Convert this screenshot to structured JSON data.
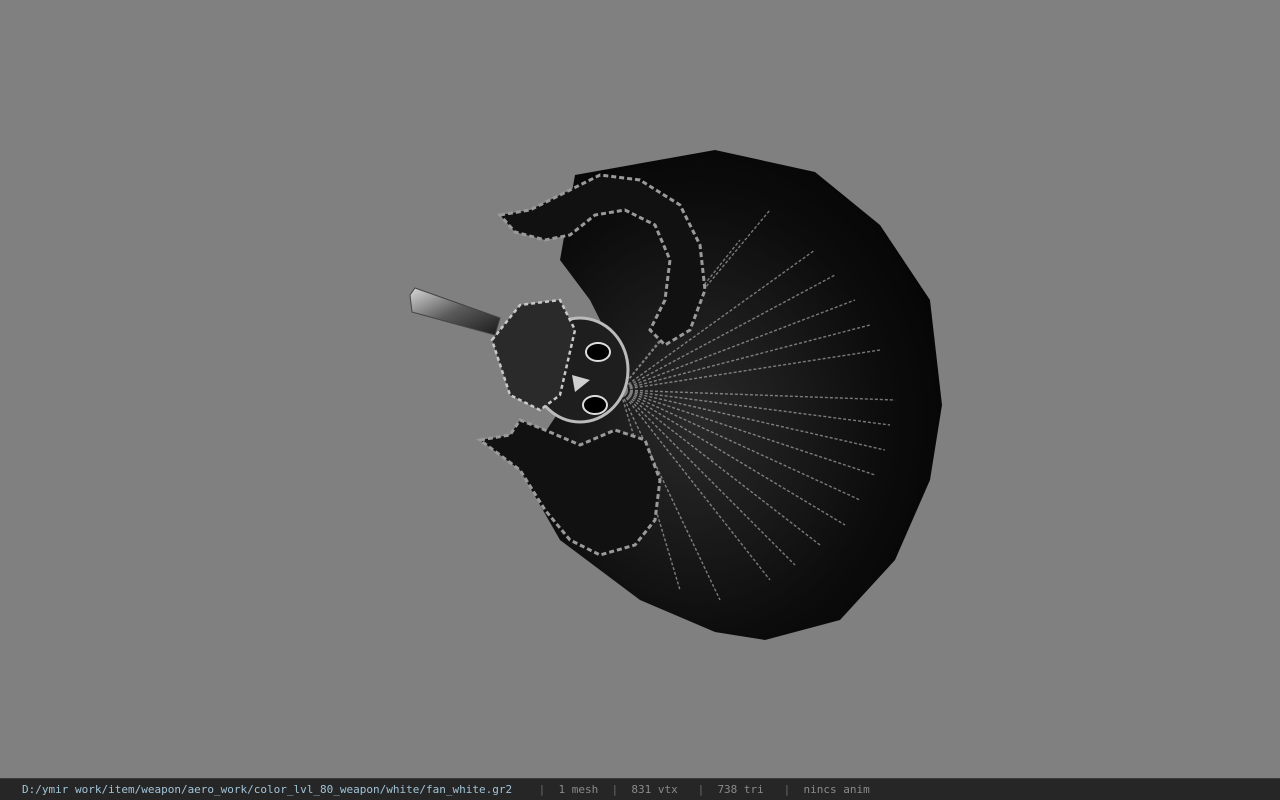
{
  "viewport": {
    "background": "#808080",
    "model_name": "fan_white"
  },
  "status": {
    "path": "D:/ymir work/item/weapon/aero_work/color_lvl_80_weapon/white/fan_white.gr2",
    "separator": "|",
    "mesh": "1 mesh",
    "vtx": "831 vtx",
    "tri": "738 tri",
    "anim": "nincs anim"
  }
}
